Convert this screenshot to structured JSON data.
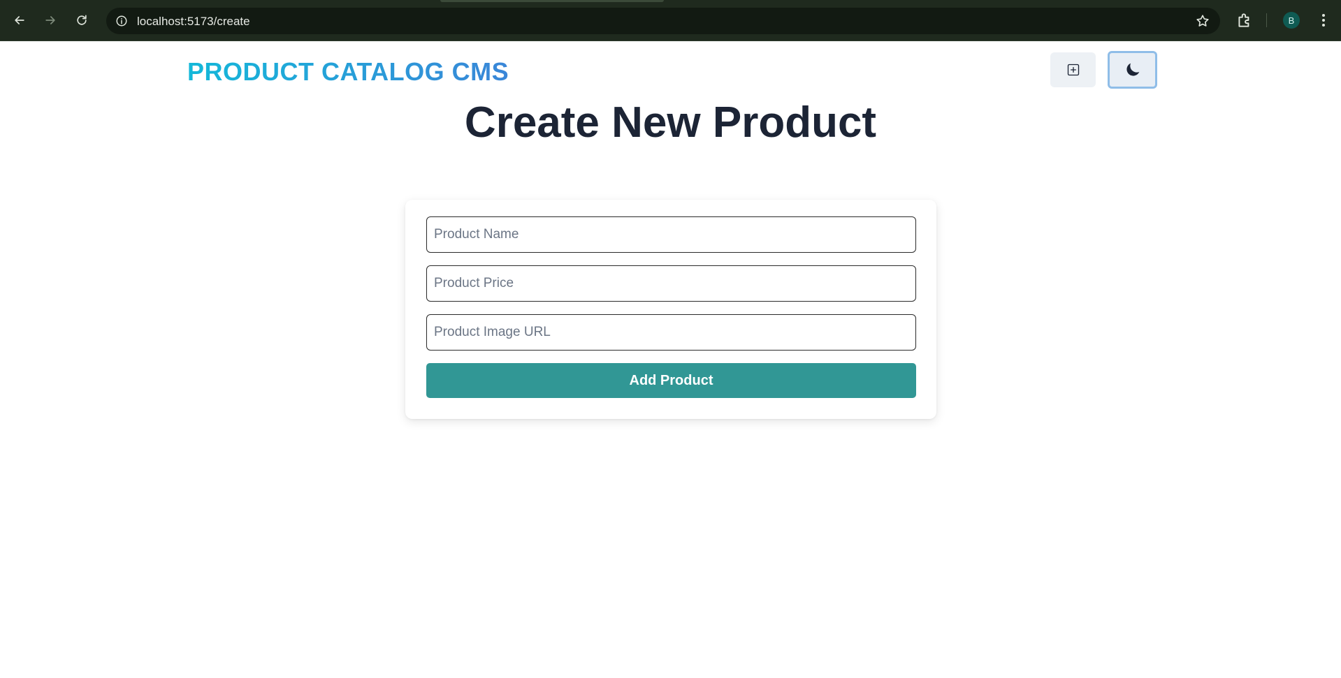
{
  "browser": {
    "url": "localhost:5173/create",
    "profile_initial": "B",
    "icons": [
      "back-arrow-icon",
      "forward-arrow-icon",
      "reload-icon",
      "info-icon",
      "star-icon",
      "extensions-icon",
      "kebab-menu-icon"
    ]
  },
  "navbar": {
    "brand": "PRODUCT CATALOG CMS",
    "create_icon": "plus-square-icon",
    "theme_icon": "moon-icon"
  },
  "page": {
    "title": "Create New Product"
  },
  "form": {
    "name_placeholder": "Product Name",
    "price_placeholder": "Product Price",
    "image_placeholder": "Product Image URL",
    "submit_label": "Add Product"
  },
  "colors": {
    "brand_gradient_start": "#14b8d9",
    "brand_gradient_end": "#3a86d8",
    "submit_bg": "#319795",
    "title_text": "#1c2435",
    "chrome_bg": "#1f2a1e"
  }
}
